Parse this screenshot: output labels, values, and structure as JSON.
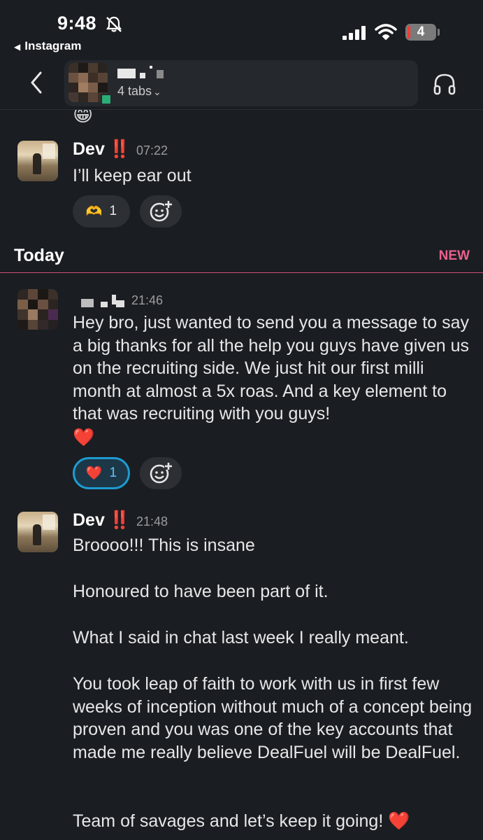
{
  "status_bar": {
    "time": "9:48",
    "back_app": "Instagram",
    "battery": "4"
  },
  "header": {
    "tabs_label": "4 tabs"
  },
  "messages": [
    {
      "sender": "Dev",
      "flag": "‼️",
      "time": "07:22",
      "text": "I’ll keep ear out",
      "reactions": [
        {
          "emoji": "🫶",
          "count": "1",
          "active": false
        }
      ]
    },
    {
      "sender": "",
      "time": "21:46",
      "text": "Hey bro, just wanted to send you a message to say a big thanks for all the help you guys have given us on the recruiting side. We just hit our first milli month at almost a 5x roas. And a key element to that was recruiting with you guys!",
      "emoji_line": "❤️",
      "reactions": [
        {
          "emoji": "❤️",
          "count": "1",
          "active": true
        }
      ]
    },
    {
      "sender": "Dev",
      "flag": "‼️",
      "time": "21:48",
      "paragraphs": [
        "Broooo!!! This is insane",
        "Honoured to have been part of it.",
        "What I said in chat last week I really meant.",
        "You took leap of faith to work with us in first few weeks of inception without much of a concept being proven and you was one of the key accounts that made me really believe DealFuel will be DealFuel.",
        "Team of savages and let’s keep it going!"
      ],
      "trailing_emoji": "❤️"
    }
  ],
  "divider": {
    "label": "Today",
    "new_label": "NEW"
  },
  "colors": {
    "background": "#1a1d21",
    "new_accent": "#e8618c",
    "active_reaction": "#1d9bd1"
  },
  "icons": [
    "bell-slash-icon",
    "signal-icon",
    "wifi-icon",
    "battery-icon",
    "back-chevron-icon",
    "headphones-icon",
    "add-reaction-icon"
  ]
}
